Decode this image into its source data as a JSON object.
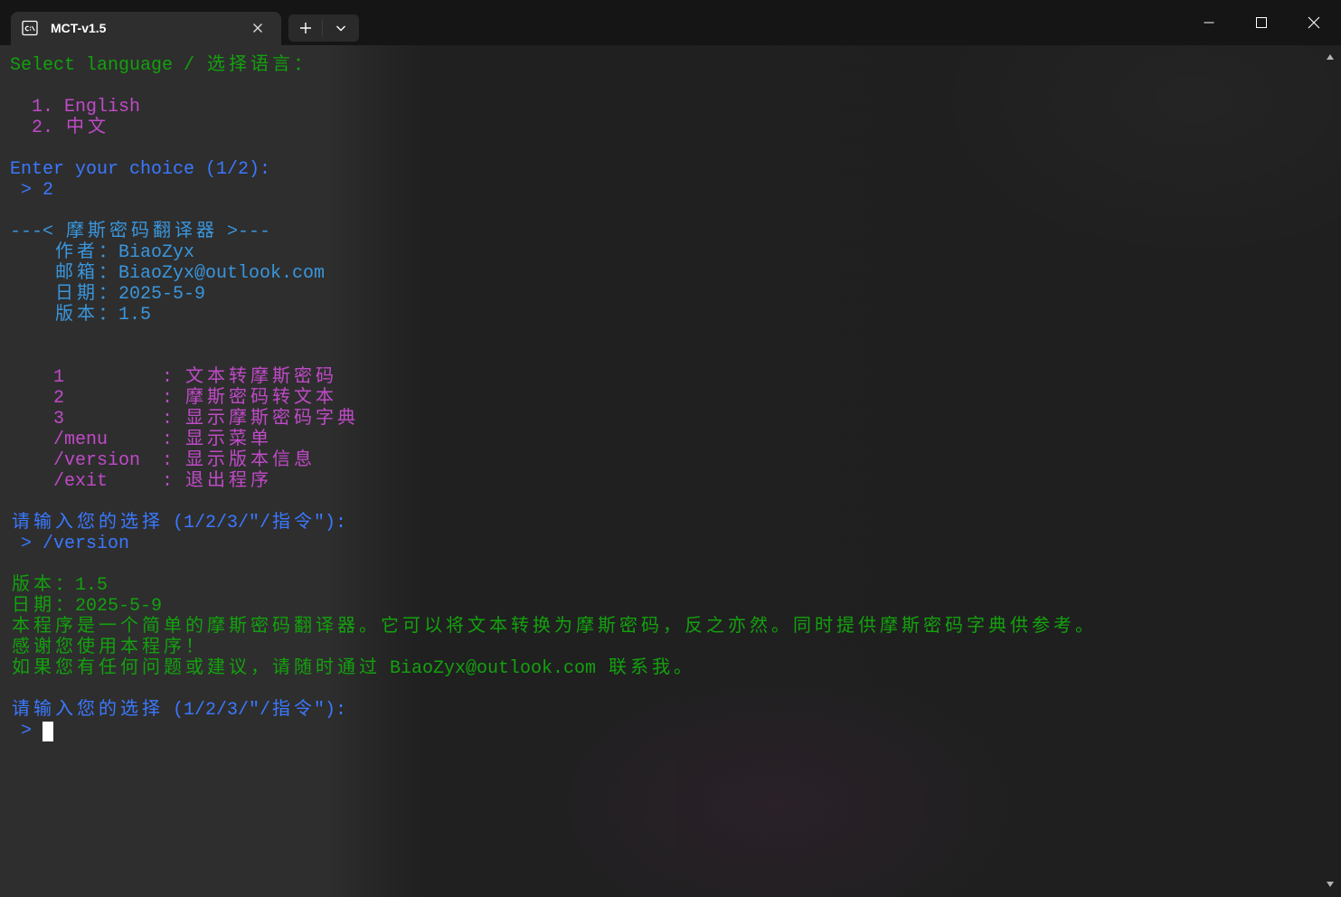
{
  "titlebar": {
    "tab": {
      "title": "MCT-v1.5",
      "icon": "terminal-icon",
      "close_icon": "close-icon"
    },
    "new_tab_icon": "plus-icon",
    "dropdown_icon": "chevron-down-icon",
    "window_controls": [
      "minimize-icon",
      "maximize-icon",
      "close-icon"
    ]
  },
  "palette": {
    "titlebar": "#151515",
    "tab": "#2e2e2e",
    "terminal_bg": "#2e2e2e",
    "green": "#13a10e",
    "magenta": "#c04ac8",
    "blue": "#3b78ff",
    "cyan": "#3a96dd",
    "foreground": "#ffffff",
    "cursor": "#ffffff"
  },
  "terminal": {
    "prompt_symbol": ">",
    "language": {
      "prompt": "Select language / 选择语言：",
      "options": [
        "1. English",
        "2. 中文"
      ],
      "choice_prompt": "Enter your choice (1/2):",
      "choice_input": "2"
    },
    "banner": {
      "title": "---< 摩斯密码翻译器 >---",
      "fields": [
        {
          "label": "作者：",
          "value": "BiaoZyx"
        },
        {
          "label": "邮箱：",
          "value": "BiaoZyx@outlook.com"
        },
        {
          "label": "日期：",
          "value": "2025-5-9"
        },
        {
          "label": "版本：",
          "value": "1.5"
        }
      ]
    },
    "menu": {
      "separator": ":",
      "items": [
        {
          "command": "1",
          "description": "文本转摩斯密码"
        },
        {
          "command": "2",
          "description": "摩斯密码转文本"
        },
        {
          "command": "3",
          "description": "显示摩斯密码字典"
        },
        {
          "command": "/menu",
          "description": "显示菜单"
        },
        {
          "command": "/version",
          "description": "显示版本信息"
        },
        {
          "command": "/exit",
          "description": "退出程序"
        }
      ],
      "prompt": "请输入您的选择 (1/2/3/\"/指令\"):",
      "input": "/version"
    },
    "version_info": {
      "version": "版本：1.5",
      "date": "日期：2025-5-9",
      "description": "本程序是一个简单的摩斯密码翻译器。它可以将文本转换为摩斯密码，反之亦然。同时提供摩斯密码字典供参考。",
      "thanks": "感谢您使用本程序！",
      "contact": "如果您有任何问题或建议，请随时通过 BiaoZyx@outlook.com 联系我。"
    },
    "next_prompt": "请输入您的选择 (1/2/3/\"/指令\"):"
  }
}
